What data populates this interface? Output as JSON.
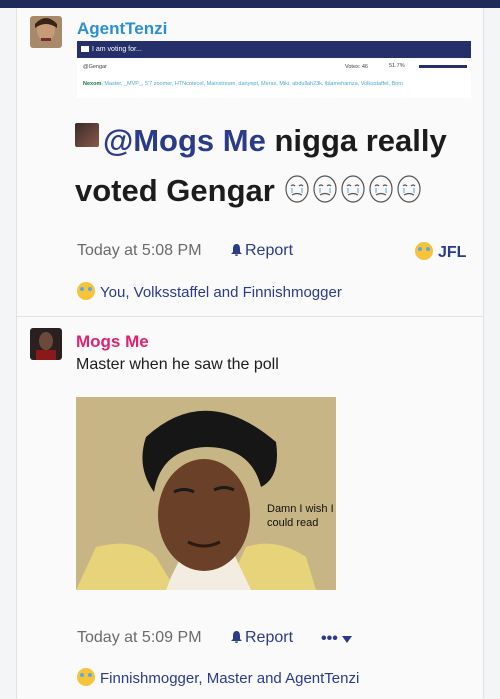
{
  "posts": [
    {
      "author": "AgentTenzi",
      "author_color": "#2b8fd6",
      "quote": {
        "header": "I am voting for...",
        "author": "@Gengar",
        "votes": "Votes: 46",
        "percent": "51.7%",
        "voters_green": "Nexom",
        "voters_text": ", Master, _MVP_, 5'7 zoomer, HTNcotecel, Mainstream, danyept, Meras, Miki, abdullah23k, iblamehamza, Volksstaffel, Born"
      },
      "message_mention": "@Mogs Me",
      "message_text": " nigga really voted Gengar",
      "timestamp": "Today at 5:08 PM",
      "report_label": "Report",
      "reaction_tag": "JFL",
      "reactions_text": "You, Volksstaffel and Finnishmogger"
    },
    {
      "author": "Mogs Me",
      "author_color": "#e02270",
      "message_text": "Master when he saw the poll",
      "meme_caption": "Damn I wish I could read",
      "timestamp": "Today at 5:09 PM",
      "report_label": "Report",
      "more_label": "•••",
      "reactions_text": "Finnishmogger, Master and AgentTenzi"
    }
  ],
  "icons": {
    "bell": "bell-icon",
    "reaction": "crying-laughing-emoji-icon",
    "more": "ellipsis-icon",
    "chevron": "chevron-down-icon"
  }
}
